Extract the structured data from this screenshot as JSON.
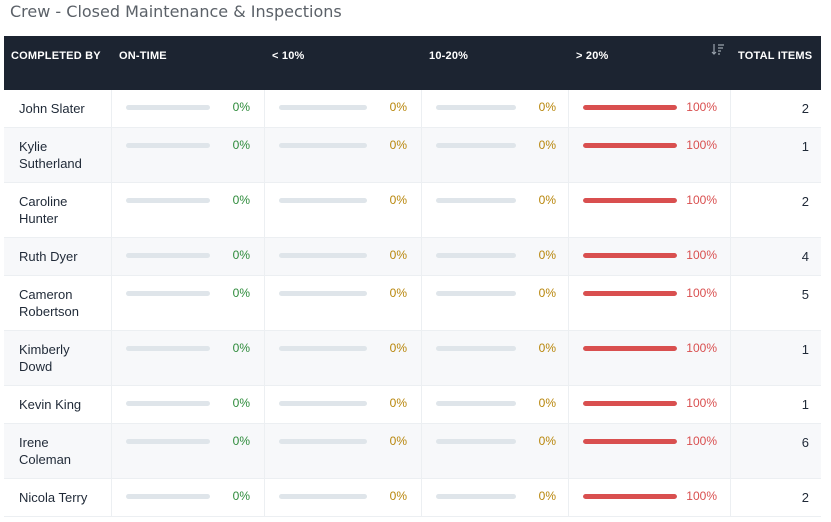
{
  "title": "Crew - Closed Maintenance & Inspections",
  "columns": {
    "completed_by": "COMPLETED BY",
    "on_time": "ON-TIME",
    "lt10": "< 10%",
    "b10_20": "10-20%",
    "gt20": "> 20%",
    "total": "TOTAL ITEMS"
  },
  "colors": {
    "on_time": "#2e8b3b",
    "lt10": "#b8860b",
    "b10_20": "#b8860b",
    "gt20": "#d94f4f",
    "track": "#dfe5ea"
  },
  "rows": [
    {
      "name": "John Slater",
      "on_time": "0%",
      "lt10": "0%",
      "b10_20": "0%",
      "gt20": "100%",
      "total": "2"
    },
    {
      "name": "Kylie Sutherland",
      "on_time": "0%",
      "lt10": "0%",
      "b10_20": "0%",
      "gt20": "100%",
      "total": "1"
    },
    {
      "name": "Caroline Hunter",
      "on_time": "0%",
      "lt10": "0%",
      "b10_20": "0%",
      "gt20": "100%",
      "total": "2"
    },
    {
      "name": "Ruth Dyer",
      "on_time": "0%",
      "lt10": "0%",
      "b10_20": "0%",
      "gt20": "100%",
      "total": "4"
    },
    {
      "name": "Cameron Robertson",
      "on_time": "0%",
      "lt10": "0%",
      "b10_20": "0%",
      "gt20": "100%",
      "total": "5"
    },
    {
      "name": "Kimberly Dowd",
      "on_time": "0%",
      "lt10": "0%",
      "b10_20": "0%",
      "gt20": "100%",
      "total": "1"
    },
    {
      "name": "Kevin King",
      "on_time": "0%",
      "lt10": "0%",
      "b10_20": "0%",
      "gt20": "100%",
      "total": "1"
    },
    {
      "name": "Irene Coleman",
      "on_time": "0%",
      "lt10": "0%",
      "b10_20": "0%",
      "gt20": "100%",
      "total": "6"
    },
    {
      "name": "Nicola Terry",
      "on_time": "0%",
      "lt10": "0%",
      "b10_20": "0%",
      "gt20": "100%",
      "total": "2"
    }
  ]
}
